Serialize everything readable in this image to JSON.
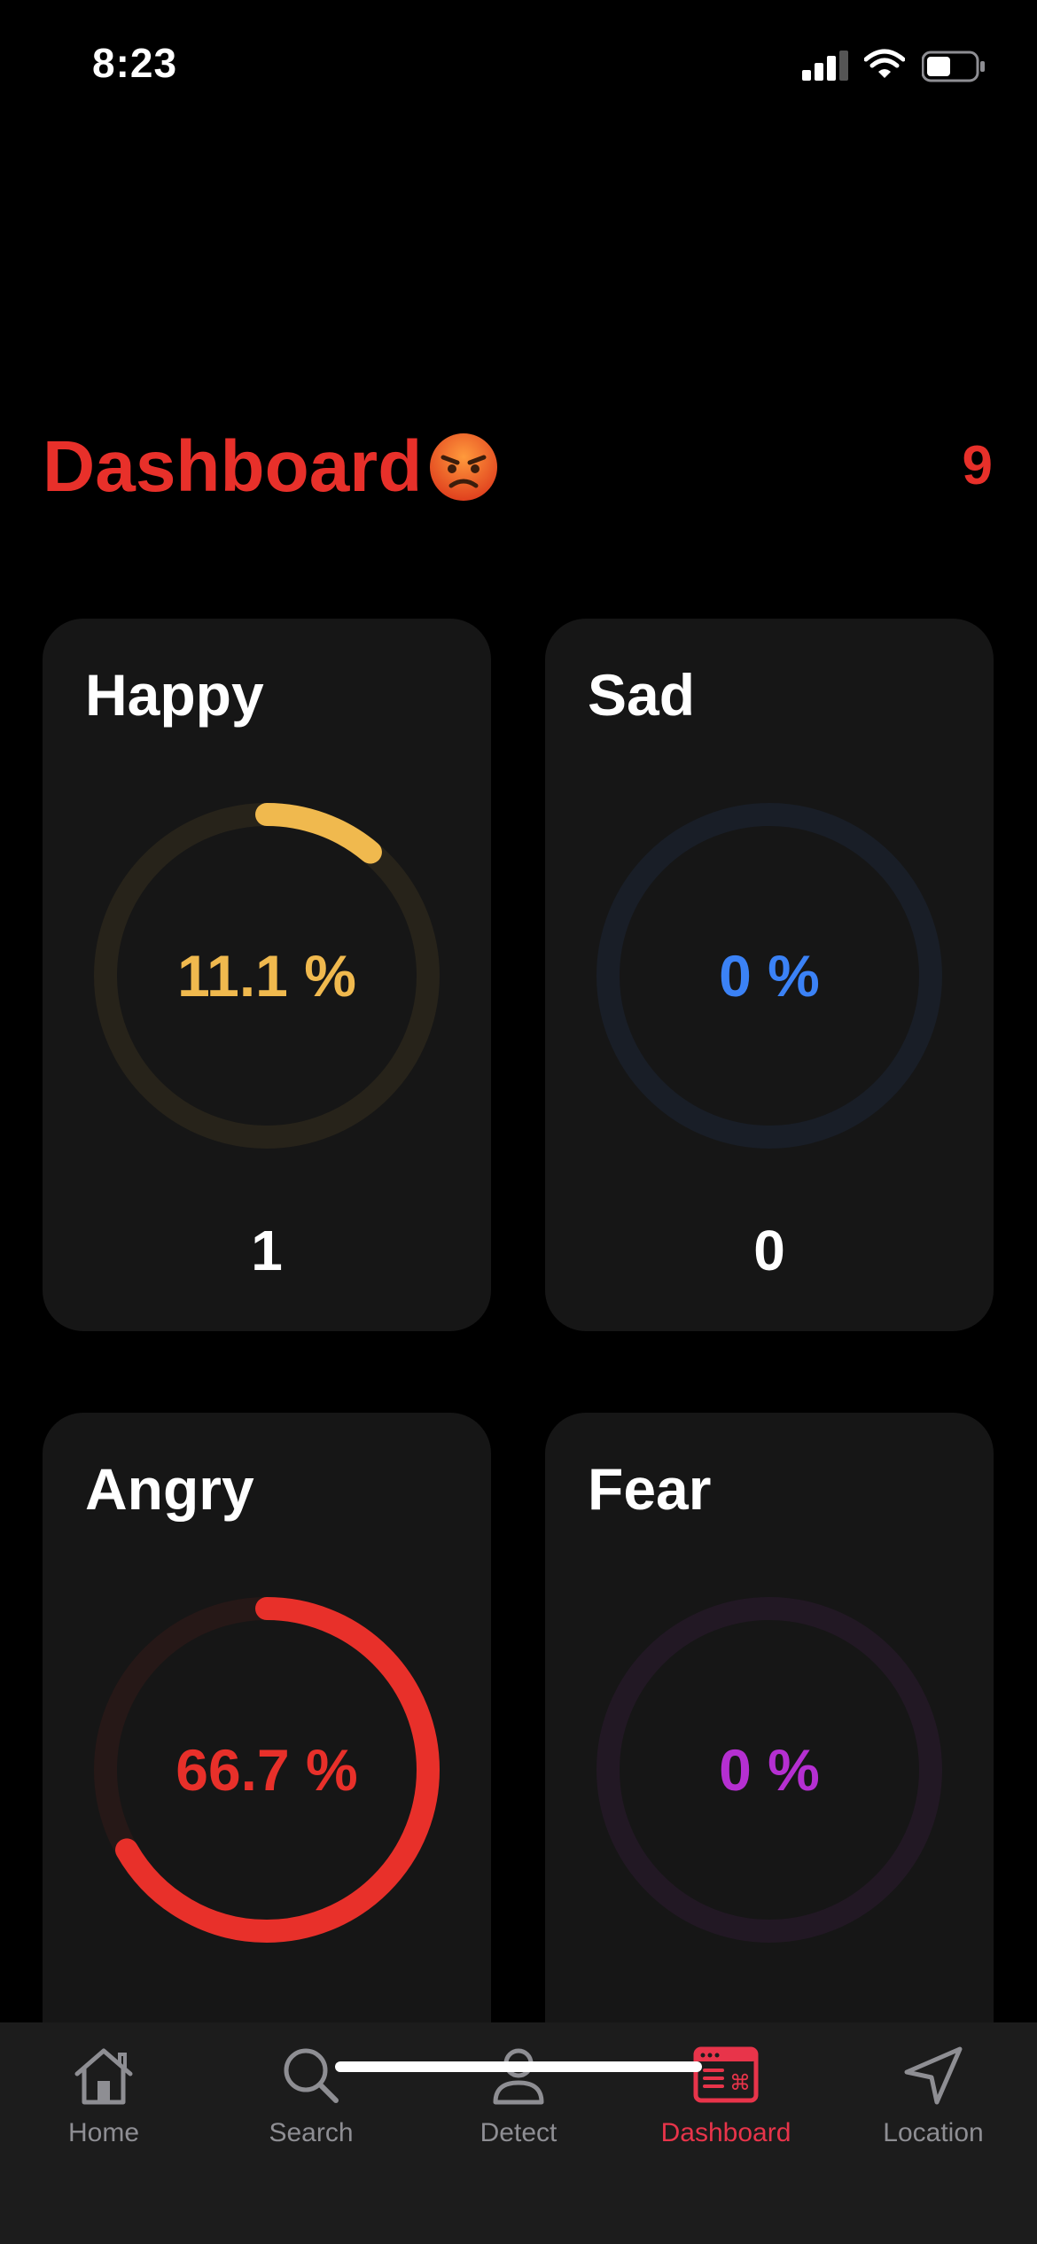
{
  "status_bar": {
    "time": "8:23"
  },
  "header": {
    "title": "Dashboard",
    "emoji": "😡",
    "count": "9"
  },
  "cards": [
    {
      "label": "Happy",
      "percent_text": "11.1 %",
      "count": "1",
      "fraction": 0.111,
      "color": "#f0b94e"
    },
    {
      "label": "Sad",
      "percent_text": "0 %",
      "count": "0",
      "fraction": 0,
      "color": "#3b82f6"
    },
    {
      "label": "Angry",
      "percent_text": "66.7 %",
      "count": "",
      "fraction": 0.667,
      "color": "#e8302a"
    },
    {
      "label": "Fear",
      "percent_text": "0 %",
      "count": "",
      "fraction": 0,
      "color": "#b52fd1"
    }
  ],
  "tabs": [
    {
      "label": "Home",
      "icon": "house-icon"
    },
    {
      "label": "Search",
      "icon": "magnifier-icon"
    },
    {
      "label": "Detect",
      "icon": "person-icon"
    },
    {
      "label": "Dashboard",
      "icon": "dashboard-window-icon",
      "active": true
    },
    {
      "label": "Location",
      "icon": "location-arrow-icon"
    }
  ],
  "colors": {
    "accent": "#e8302a",
    "tab_active": "#e8344a",
    "tab_inactive": "#8e8e93"
  }
}
